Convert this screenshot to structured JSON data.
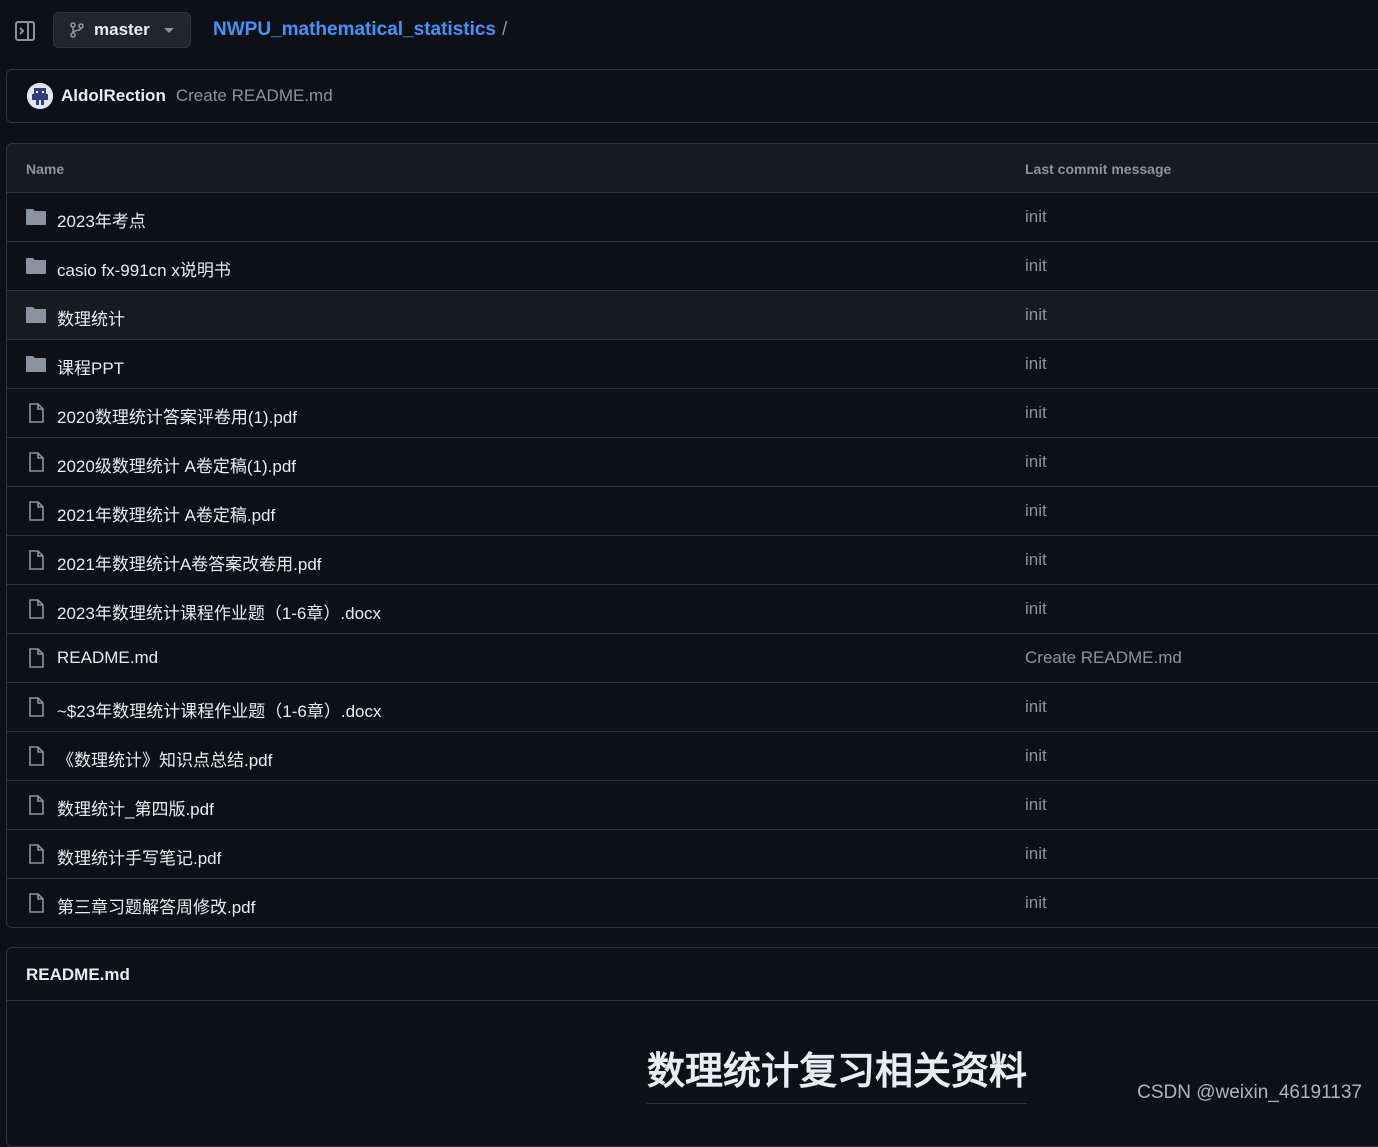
{
  "header": {
    "branch": "master",
    "repo": "NWPU_mathematical_statistics",
    "separator": "/"
  },
  "commit": {
    "author": "AldolRection",
    "message": "Create README.md"
  },
  "table": {
    "col_name": "Name",
    "col_message": "Last commit message",
    "rows": [
      {
        "type": "folder",
        "name": "2023年考点",
        "message": "init"
      },
      {
        "type": "folder",
        "name": "casio fx-991cn x说明书",
        "message": "init"
      },
      {
        "type": "folder",
        "name": "数理统计",
        "message": "init"
      },
      {
        "type": "folder",
        "name": "课程PPT",
        "message": "init"
      },
      {
        "type": "file",
        "name": "2020数理统计答案评卷用(1).pdf",
        "message": "init"
      },
      {
        "type": "file",
        "name": "2020级数理统计 A卷定稿(1).pdf",
        "message": "init"
      },
      {
        "type": "file",
        "name": "2021年数理统计 A卷定稿.pdf",
        "message": "init"
      },
      {
        "type": "file",
        "name": "2021年数理统计A卷答案改卷用.pdf",
        "message": "init"
      },
      {
        "type": "file",
        "name": "2023年数理统计课程作业题（1-6章）.docx",
        "message": "init"
      },
      {
        "type": "file",
        "name": "README.md",
        "message": "Create README.md"
      },
      {
        "type": "file",
        "name": "~$23年数理统计课程作业题（1-6章）.docx",
        "message": "init"
      },
      {
        "type": "file",
        "name": "《数理统计》知识点总结.pdf",
        "message": "init"
      },
      {
        "type": "file",
        "name": "数理统计_第四版.pdf",
        "message": "init"
      },
      {
        "type": "file",
        "name": "数理统计手写笔记.pdf",
        "message": "init"
      },
      {
        "type": "file",
        "name": "第三章习题解答周修改.pdf",
        "message": "init"
      }
    ]
  },
  "readme": {
    "title": "README.md",
    "heading": "数理统计复习相关资料"
  },
  "watermark": "CSDN @weixin_46191137",
  "colors": {
    "background": "#0d1117",
    "link": "#4493f8",
    "muted": "#8b949e",
    "border": "#30363d"
  }
}
